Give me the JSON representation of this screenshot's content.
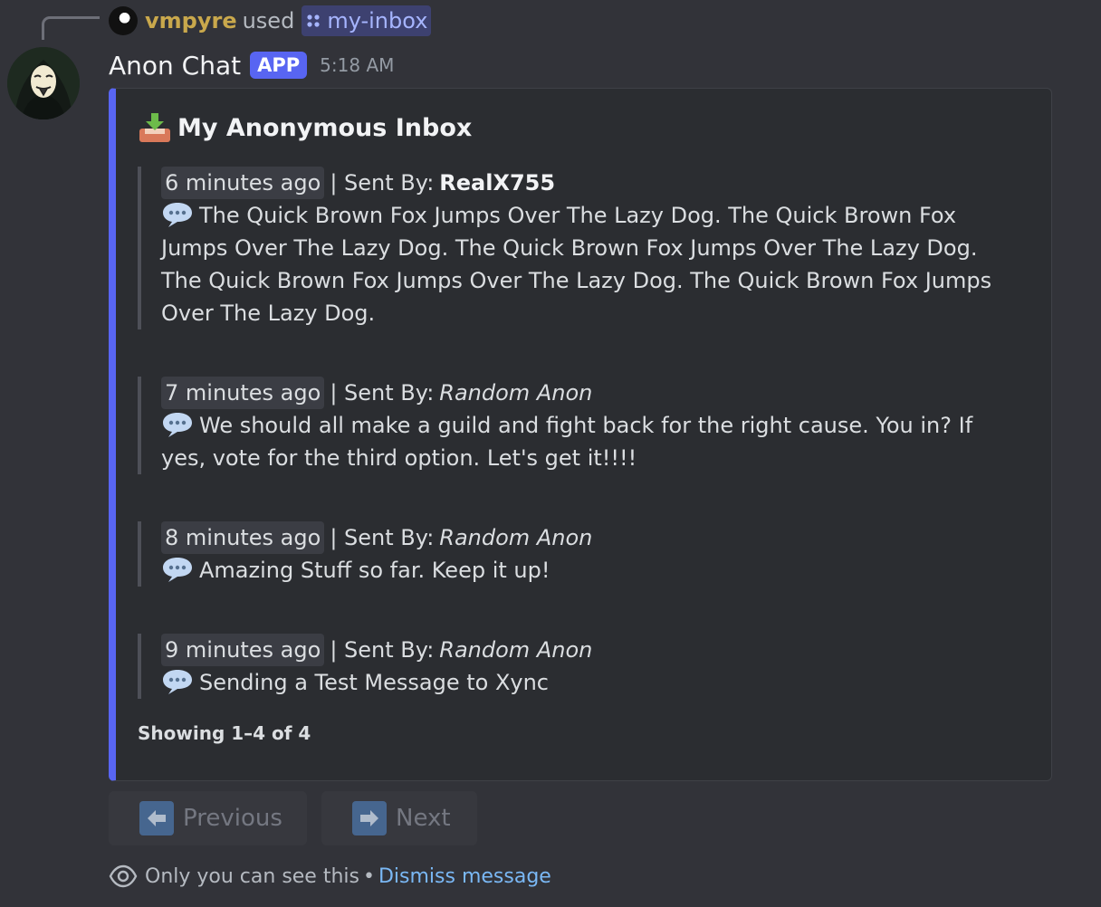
{
  "reply": {
    "username": "vmpyre",
    "used_text": "used",
    "command": "my-inbox"
  },
  "message": {
    "author": "Anon Chat",
    "badge": "APP",
    "time": "5:18 AM"
  },
  "embed": {
    "accent_color": "#5865f2",
    "title": "My Anonymous Inbox",
    "sent_by_label": "| Sent By:",
    "messages": [
      {
        "ago": "6 minutes ago",
        "sender": "RealX755",
        "sender_style": "bold",
        "text": "The Quick Brown Fox Jumps Over The Lazy Dog. The Quick Brown Fox Jumps Over The Lazy Dog. The Quick Brown Fox Jumps Over The Lazy Dog. The Quick Brown Fox Jumps Over The Lazy Dog. The Quick Brown Fox Jumps Over The Lazy Dog."
      },
      {
        "ago": "7 minutes ago",
        "sender": "Random Anon",
        "sender_style": "italic",
        "text": "We should all make a guild and fight back for the right cause. You in? If yes, vote for the third option. Let's get it!!!!"
      },
      {
        "ago": "8 minutes ago",
        "sender": "Random Anon",
        "sender_style": "italic",
        "text": "Amazing Stuff so far. Keep it up!"
      },
      {
        "ago": "9 minutes ago",
        "sender": "Random Anon",
        "sender_style": "italic",
        "text": "Sending a Test Message to Xync"
      }
    ],
    "footer": "Showing 1–4 of 4"
  },
  "buttons": {
    "previous": "Previous",
    "next": "Next"
  },
  "ephemeral": {
    "notice": "Only you can see this",
    "bullet": "•",
    "dismiss": "Dismiss message"
  },
  "icons": {
    "reply_avatar": "user-avatar-icon",
    "command": "slash-command-icon",
    "bot_avatar": "anonymous-mask-avatar",
    "inbox": "inbox-tray-icon",
    "message": "speech-bubble-icon",
    "previous": "arrow-left-icon",
    "next": "arrow-right-icon",
    "visibility": "eye-icon"
  }
}
